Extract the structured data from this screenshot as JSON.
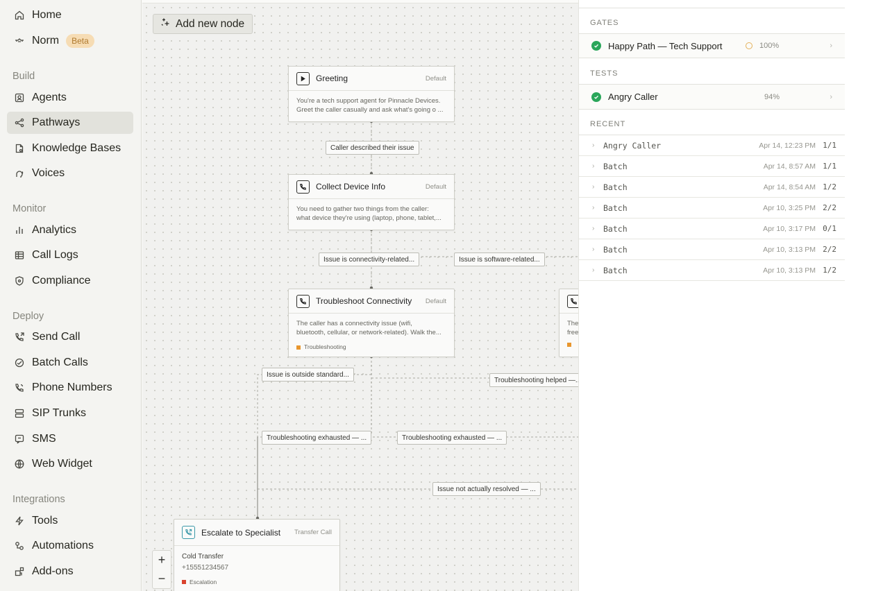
{
  "sidebar": {
    "home": "Home",
    "norm": "Norm",
    "norm_badge": "Beta",
    "build_label": "Build",
    "agents": "Agents",
    "pathways": "Pathways",
    "knowledge_bases": "Knowledge Bases",
    "voices": "Voices",
    "monitor_label": "Monitor",
    "analytics": "Analytics",
    "call_logs": "Call Logs",
    "compliance": "Compliance",
    "deploy_label": "Deploy",
    "send_call": "Send Call",
    "batch_calls": "Batch Calls",
    "phone_numbers": "Phone Numbers",
    "sip_trunks": "SIP Trunks",
    "sms": "SMS",
    "web_widget": "Web Widget",
    "integrations_label": "Integrations",
    "tools": "Tools",
    "automations": "Automations",
    "add_ons": "Add-ons"
  },
  "canvas": {
    "add_node": "Add new node",
    "zoom_in": "+",
    "zoom_out": "−",
    "nodes": {
      "greeting": {
        "title": "Greeting",
        "kind": "Default",
        "line1": "You're a tech support agent for Pinnacle Devices.",
        "line2": "Greet the caller casually and ask what's going o ..."
      },
      "collect": {
        "title": "Collect Device Info",
        "kind": "Default",
        "line1": "You need to gather two things from the caller:",
        "line2": "what device they're using (laptop, phone, tablet,..."
      },
      "troubleshoot": {
        "title": "Troubleshoot Connectivity",
        "kind": "Default",
        "line1": "The caller has a connectivity issue (wifi,",
        "line2": "bluetooth, cellular, or network-related). Walk the...",
        "tag": "Troubleshooting"
      },
      "partial": {
        "line1": "The",
        "line2": "free"
      },
      "escalate": {
        "title": "Escalate to Specialist",
        "kind": "Transfer Call",
        "line1": "Cold Transfer",
        "line2": "+15551234567",
        "tag": "Escalation"
      }
    },
    "edges": {
      "described": "Caller described their issue",
      "connectivity": "Issue is connectivity-related...",
      "software": "Issue is software-related...",
      "outside": "Issue is outside standard...",
      "helped": "Troubleshooting helped —...",
      "exhausted1": "Troubleshooting exhausted — ...",
      "exhausted2": "Troubleshooting exhausted — ...",
      "not_resolved": "Issue not actually resolved — ..."
    },
    "colors": {
      "troubleshooting_tag": "#e8962e",
      "escalation_tag": "#d9422e"
    }
  },
  "panel": {
    "gates_label": "GATES",
    "gate": {
      "name": "Happy Path — Tech Support",
      "pct": "100%"
    },
    "tests_label": "TESTS",
    "test": {
      "name": "Angry Caller",
      "pct": "94%"
    },
    "recent_label": "RECENT",
    "recent": [
      {
        "name": "Angry Caller",
        "date": "Apr 14, 12:23 PM",
        "count": "1/1"
      },
      {
        "name": "Batch",
        "date": "Apr 14, 8:57 AM",
        "count": "1/1"
      },
      {
        "name": "Batch",
        "date": "Apr 14, 8:54 AM",
        "count": "1/2"
      },
      {
        "name": "Batch",
        "date": "Apr 10, 3:25 PM",
        "count": "2/2"
      },
      {
        "name": "Batch",
        "date": "Apr 10, 3:17 PM",
        "count": "0/1"
      },
      {
        "name": "Batch",
        "date": "Apr 10, 3:13 PM",
        "count": "2/2"
      },
      {
        "name": "Batch",
        "date": "Apr 10, 3:13 PM",
        "count": "1/2"
      }
    ]
  }
}
